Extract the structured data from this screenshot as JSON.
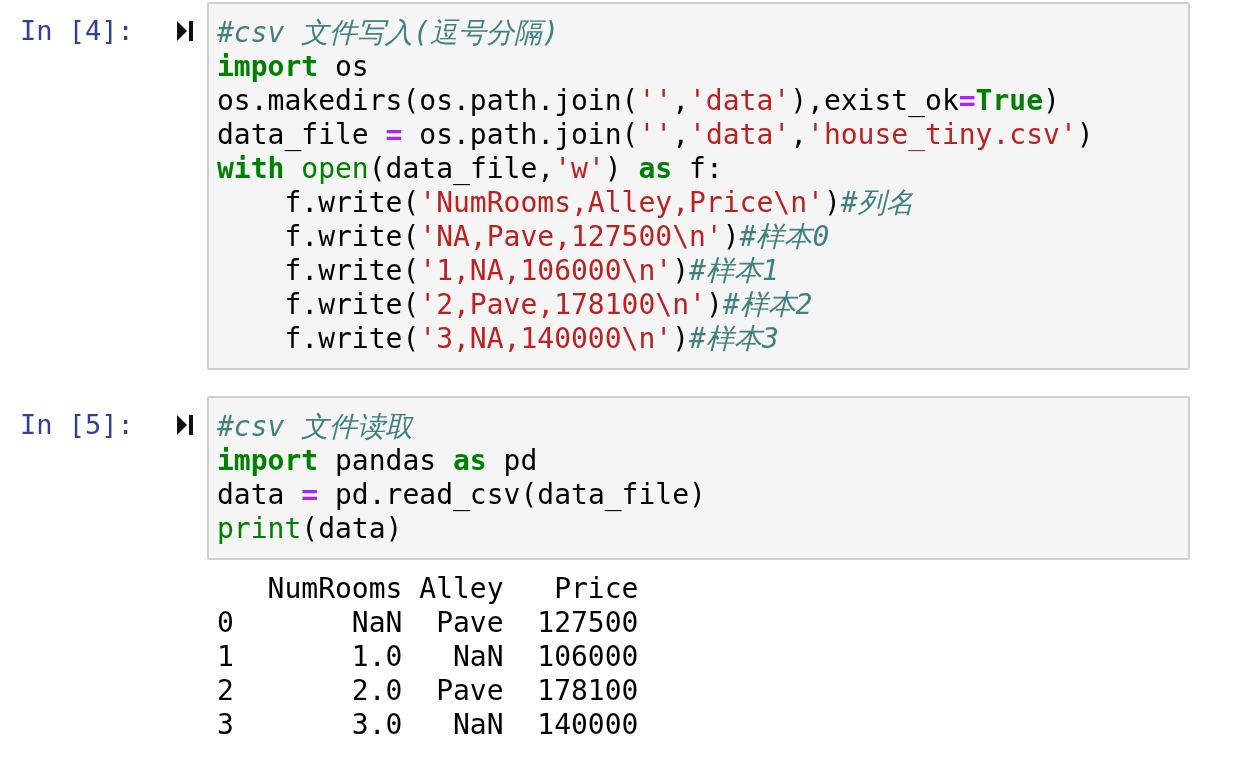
{
  "cells": [
    {
      "prompt": "In [4]:",
      "code": [
        [
          {
            "kind": "comment",
            "text": "#csv 文件写入(逗号分隔)"
          }
        ],
        [
          {
            "kind": "keyword",
            "text": "import"
          },
          {
            "kind": "text",
            "text": " os"
          }
        ],
        [
          {
            "kind": "text",
            "text": "os.makedirs(os.path.join("
          },
          {
            "kind": "string",
            "text": "''"
          },
          {
            "kind": "text",
            "text": ","
          },
          {
            "kind": "string",
            "text": "'data'"
          },
          {
            "kind": "text",
            "text": "),exist_ok"
          },
          {
            "kind": "operator",
            "text": "="
          },
          {
            "kind": "keyword",
            "text": "True"
          },
          {
            "kind": "text",
            "text": ")"
          }
        ],
        [
          {
            "kind": "text",
            "text": "data_file "
          },
          {
            "kind": "operator",
            "text": "="
          },
          {
            "kind": "text",
            "text": " os.path.join("
          },
          {
            "kind": "string",
            "text": "''"
          },
          {
            "kind": "text",
            "text": ","
          },
          {
            "kind": "string",
            "text": "'data'"
          },
          {
            "kind": "text",
            "text": ","
          },
          {
            "kind": "string",
            "text": "'house_tiny.csv'"
          },
          {
            "kind": "text",
            "text": ")"
          }
        ],
        [
          {
            "kind": "keyword",
            "text": "with "
          },
          {
            "kind": "builtin",
            "text": "open"
          },
          {
            "kind": "text",
            "text": "(data_file,"
          },
          {
            "kind": "string",
            "text": "'w'"
          },
          {
            "kind": "text",
            "text": ") "
          },
          {
            "kind": "keyword",
            "text": "as"
          },
          {
            "kind": "text",
            "text": " f:"
          }
        ],
        [
          {
            "kind": "text",
            "text": "    f.write("
          },
          {
            "kind": "string",
            "text": "'NumRooms,Alley,Price\\n'"
          },
          {
            "kind": "text",
            "text": ")"
          },
          {
            "kind": "comment",
            "text": "#列名"
          }
        ],
        [
          {
            "kind": "text",
            "text": "    f.write("
          },
          {
            "kind": "string",
            "text": "'NA,Pave,127500\\n'"
          },
          {
            "kind": "text",
            "text": ")"
          },
          {
            "kind": "comment",
            "text": "#样本0"
          }
        ],
        [
          {
            "kind": "text",
            "text": "    f.write("
          },
          {
            "kind": "string",
            "text": "'1,NA,106000\\n'"
          },
          {
            "kind": "text",
            "text": ")"
          },
          {
            "kind": "comment",
            "text": "#样本1"
          }
        ],
        [
          {
            "kind": "text",
            "text": "    f.write("
          },
          {
            "kind": "string",
            "text": "'2,Pave,178100\\n'"
          },
          {
            "kind": "text",
            "text": ")"
          },
          {
            "kind": "comment",
            "text": "#样本2"
          }
        ],
        [
          {
            "kind": "text",
            "text": "    f.write("
          },
          {
            "kind": "string",
            "text": "'3,NA,140000\\n'"
          },
          {
            "kind": "text",
            "text": ")"
          },
          {
            "kind": "comment",
            "text": "#样本3"
          }
        ]
      ]
    },
    {
      "prompt": "In [5]:",
      "code": [
        [
          {
            "kind": "comment",
            "text": "#csv 文件读取"
          }
        ],
        [
          {
            "kind": "keyword",
            "text": "import"
          },
          {
            "kind": "text",
            "text": " pandas "
          },
          {
            "kind": "keyword",
            "text": "as"
          },
          {
            "kind": "text",
            "text": " pd"
          }
        ],
        [
          {
            "kind": "text",
            "text": "data "
          },
          {
            "kind": "operator",
            "text": "="
          },
          {
            "kind": "text",
            "text": " pd.read_csv(data_file)"
          }
        ],
        [
          {
            "kind": "builtin",
            "text": "print"
          },
          {
            "kind": "text",
            "text": "(data)"
          }
        ]
      ],
      "output": [
        "   NumRooms Alley   Price",
        "0       NaN  Pave  127500",
        "1       1.0   NaN  106000",
        "2       2.0  Pave  178100",
        "3       3.0   NaN  140000"
      ]
    }
  ]
}
